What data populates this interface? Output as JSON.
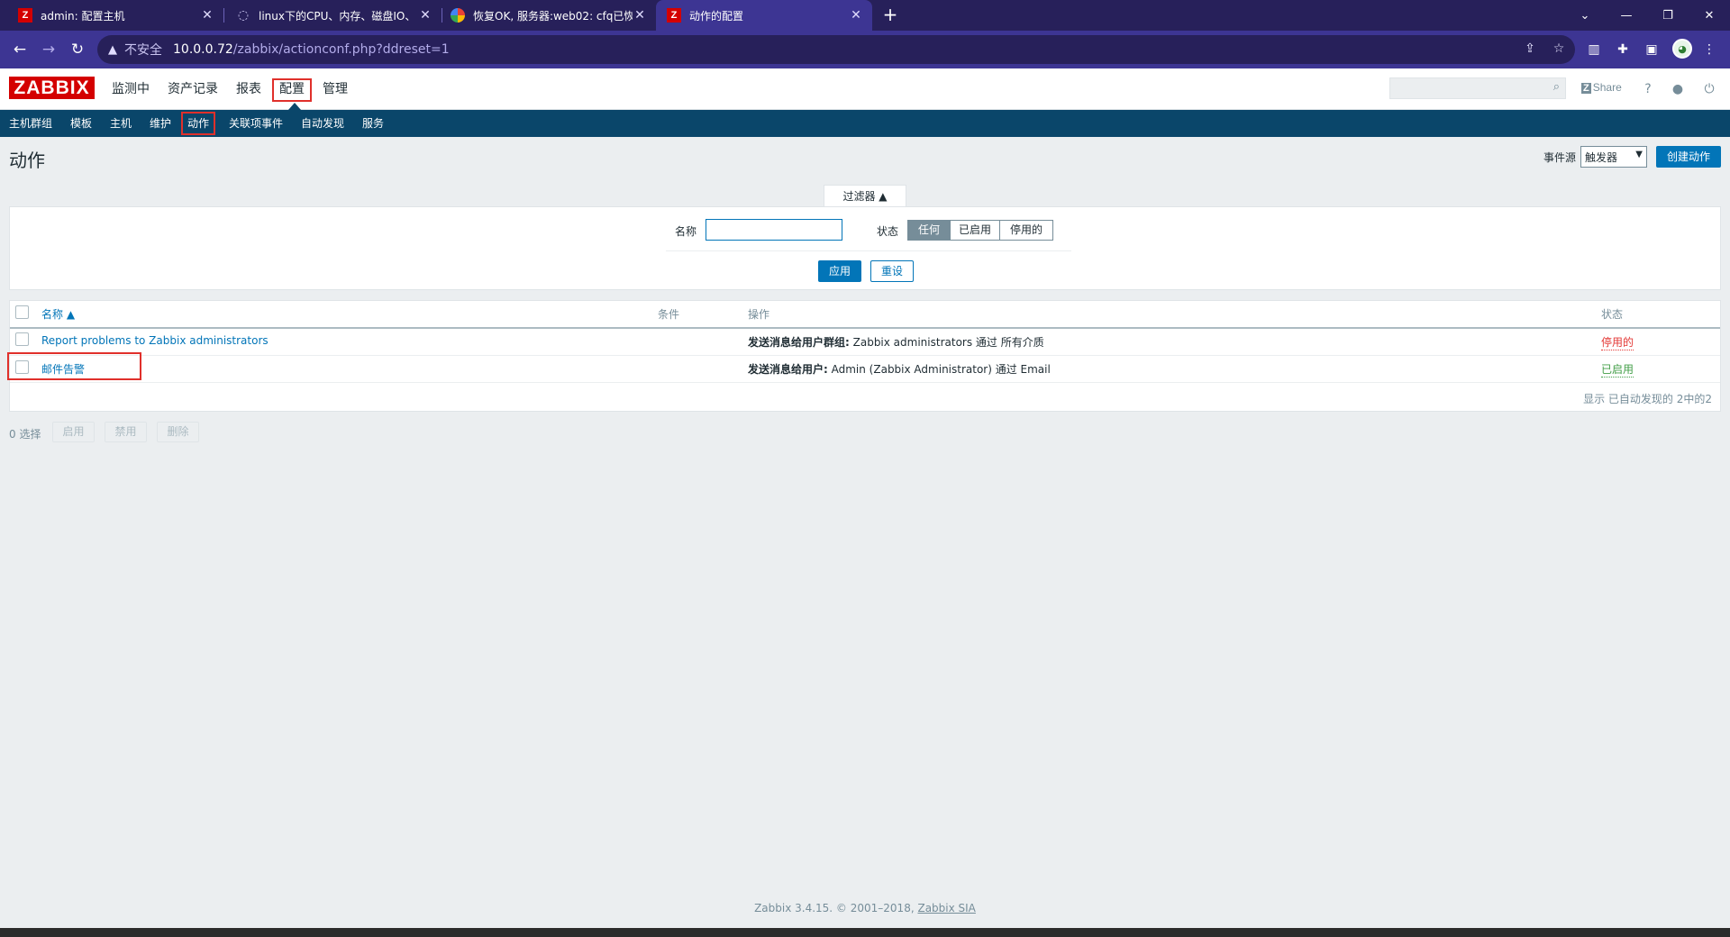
{
  "browser": {
    "tabs": [
      {
        "title": "admin: 配置主机",
        "favicon": "zabbix-icon",
        "active": false
      },
      {
        "title": "linux下的CPU、内存、磁盘IO、",
        "favicon": "loading-icon",
        "active": false
      },
      {
        "title": "恢复OK, 服务器:web02: cfq已恢",
        "favicon": "chrome-icon",
        "active": false
      },
      {
        "title": "动作的配置",
        "favicon": "zabbix-icon",
        "active": true
      }
    ],
    "security_label": "不安全",
    "url_host": "10.0.0.72",
    "url_path": "/zabbix/actionconf.php?ddreset=1",
    "theme_color": "#3d3593"
  },
  "zabbix": {
    "logo": "ZABBIX",
    "main_menu": [
      "监测中",
      "资产记录",
      "报表",
      "配置",
      "管理"
    ],
    "share_label": "Share",
    "sub_menu": [
      "主机群组",
      "模板",
      "主机",
      "维护",
      "动作",
      "关联项事件",
      "自动发现",
      "服务"
    ],
    "accent": "#0275b8",
    "header_color": "#0a466a"
  },
  "page": {
    "title": "动作",
    "event_source_label": "事件源",
    "event_source_value": "触发器",
    "create_button": "创建动作"
  },
  "filter": {
    "tab_label": "过滤器 ▲",
    "name_label": "名称",
    "name_value": "",
    "status_label": "状态",
    "status_options": [
      "任何",
      "已启用",
      "停用的"
    ],
    "status_selected": "任何",
    "apply_button": "应用",
    "reset_button": "重设"
  },
  "table": {
    "headers": {
      "name": "名称 ▲",
      "conditions": "条件",
      "operations": "操作",
      "status": "状态"
    },
    "rows": [
      {
        "name": "Report problems to Zabbix administrators",
        "conditions": "",
        "op_bold": "发送消息给用户群组:",
        "op_text": " Zabbix administrators 通过 所有介质",
        "status": "停用的"
      },
      {
        "name": "邮件告警",
        "conditions": "",
        "op_bold": "发送消息给用户:",
        "op_text": " Admin (Zabbix Administrator) 通过 Email",
        "status": "已启用"
      }
    ],
    "paging": "显示 已自动发现的 2中的2"
  },
  "mass_actions": {
    "selected": "0 选择",
    "buttons": [
      "启用",
      "禁用",
      "删除"
    ]
  },
  "footer": {
    "text": "Zabbix 3.4.15. © 2001–2018, ",
    "link": "Zabbix SIA"
  }
}
